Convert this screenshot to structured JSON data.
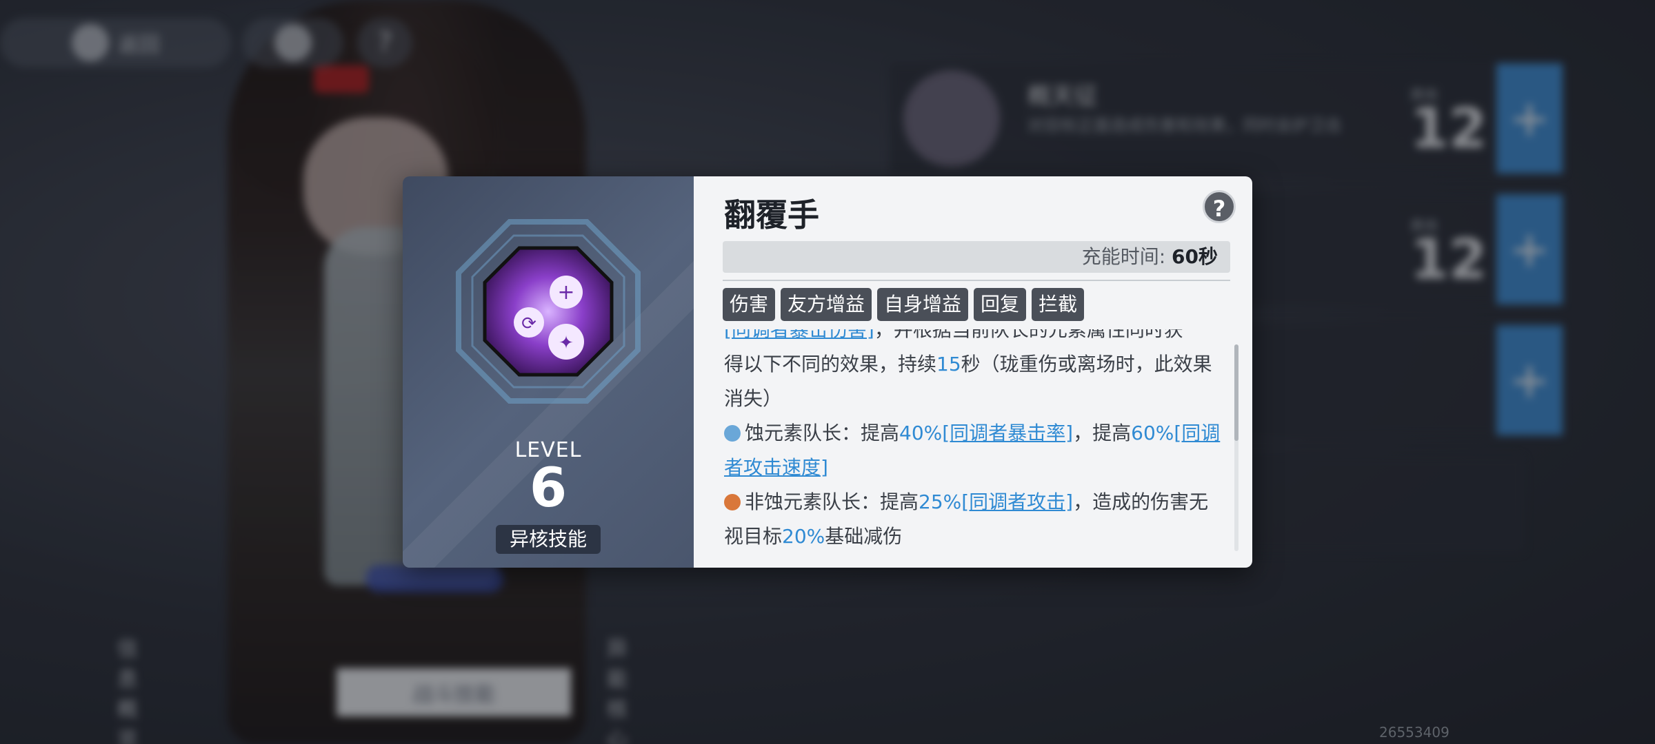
{
  "background": {
    "back_label": "返回",
    "card1_title": "概天征",
    "card1_desc": "对目标正面造成伤害和效果，同时会护卫击",
    "card_stat_label": "费用",
    "card_values": [
      "12",
      "12"
    ],
    "tabs": [
      "信息概览",
      "战斗技能",
      "异能核心"
    ],
    "build_id": "26553409"
  },
  "dialog": {
    "skill_name": "翻覆手",
    "help_symbol": "?",
    "charge_label": "充能时间:",
    "charge_value": "60秒",
    "level_label": "LEVEL",
    "level_value": "6",
    "skill_type": "异核技能",
    "tags": [
      "伤害",
      "友方增益",
      "自身增益",
      "回复",
      "拦截"
    ],
    "desc": {
      "cut_link": "[同调者暴击伤害]",
      "cut_text": "，并根据当前队长的元素属性同时获",
      "line1a": "得以下不同的效果，持续",
      "line1_num": "15",
      "line1b": "秒（珑重伤或离场时，此效果消失）",
      "bullet1_label": "蚀元素队长：提高",
      "bullet1_num1": "40%",
      "bullet1_link1": "[同调者暴击率]",
      "bullet1_mid": "，提高",
      "bullet1_num2": "60%",
      "bullet1_link2": "[同调者攻击速度]",
      "bullet2_label": "非蚀元素队长：提高",
      "bullet2_num1": "25%",
      "bullet2_link1": "[同调者攻击]",
      "bullet2_mid": "，造成的伤害无视目标",
      "bullet2_num2": "20%",
      "bullet2_end": "基础减伤"
    }
  },
  "colors": {
    "accent_blue": "#2f8ad3",
    "plus_blue": "#3d8fd8",
    "tag_bg": "#4a4f58"
  }
}
